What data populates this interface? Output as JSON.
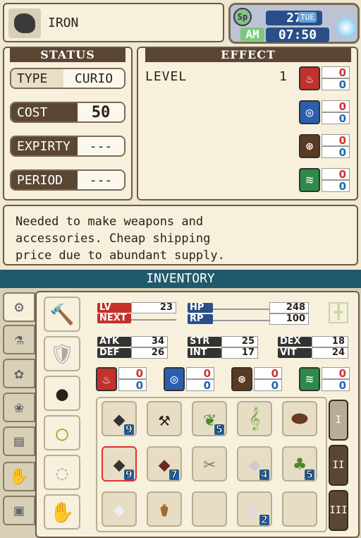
{
  "item": {
    "name": "IRON",
    "icon": "ore-rock-icon"
  },
  "clock": {
    "day": "27",
    "weekday": "TUE",
    "ampm": "AM",
    "time": "07:50",
    "sp_label": "Sp",
    "weather_icon": "sun-icon"
  },
  "status": {
    "title": "STATUS",
    "type_label": "TYPE",
    "type_value": "CURIO",
    "cost_label": "COST",
    "cost_value": "50",
    "expiry_label": "EXPIRTY",
    "expiry_value": "---",
    "period_label": "PERIOD",
    "period_value": "---"
  },
  "effect": {
    "title": "EFFECT",
    "level_label": "LEVEL",
    "level_value": "1",
    "elements": [
      {
        "name": "fire-icon",
        "top": "0",
        "bottom": "0",
        "color": "#c4302b"
      },
      {
        "name": "water-icon",
        "top": "0",
        "bottom": "0",
        "color": "#2a5fae"
      },
      {
        "name": "earth-icon",
        "top": "0",
        "bottom": "0",
        "color": "#5a3a22"
      },
      {
        "name": "wind-icon",
        "top": "0",
        "bottom": "0",
        "color": "#2e8a4a"
      }
    ]
  },
  "description": "Needed to make weapons and\naccessories. Cheap shipping\nprice due to abundant supply.",
  "inventory": {
    "title": "INVENTORY",
    "lv_label": "LV",
    "lv": "23",
    "next_label": "NEXT",
    "hp_label": "HP",
    "hp": "248",
    "rp_label": "RP",
    "rp": "100",
    "stats": {
      "atk_l": "ATK",
      "atk": "34",
      "def_l": "DEF",
      "def": "26",
      "str_l": "STR",
      "str": "25",
      "int_l": "INT",
      "int": "17",
      "dex_l": "DEX",
      "dex": "18",
      "vit_l": "VIT",
      "vit": "24"
    },
    "elements": [
      {
        "name": "fire-icon",
        "top": "0",
        "bottom": "0"
      },
      {
        "name": "water-icon",
        "top": "0",
        "bottom": "0"
      },
      {
        "name": "earth-icon",
        "top": "0",
        "bottom": "0"
      },
      {
        "name": "wind-icon",
        "top": "0",
        "bottom": "0"
      }
    ],
    "slots": [
      {
        "name": "iron-ore",
        "qty": "9"
      },
      {
        "name": "sickle",
        "qty": ""
      },
      {
        "name": "herb",
        "qty": "5"
      },
      {
        "name": "bamboo-sprout",
        "qty": ""
      },
      {
        "name": "brush",
        "qty": ""
      },
      {
        "name": "iron-ore",
        "qty": "9"
      },
      {
        "name": "red-stone",
        "qty": "7"
      },
      {
        "name": "fish-bones",
        "qty": ""
      },
      {
        "name": "silver-ore",
        "qty": "4"
      },
      {
        "name": "tree-sapling",
        "qty": "5"
      },
      {
        "name": "white-crystal",
        "qty": ""
      },
      {
        "name": "potion-jar",
        "qty": ""
      },
      {
        "name": "empty",
        "qty": ""
      },
      {
        "name": "white-ore",
        "qty": "2"
      },
      {
        "name": "empty",
        "qty": ""
      }
    ],
    "tabs": [
      "I",
      "II",
      "III"
    ]
  }
}
